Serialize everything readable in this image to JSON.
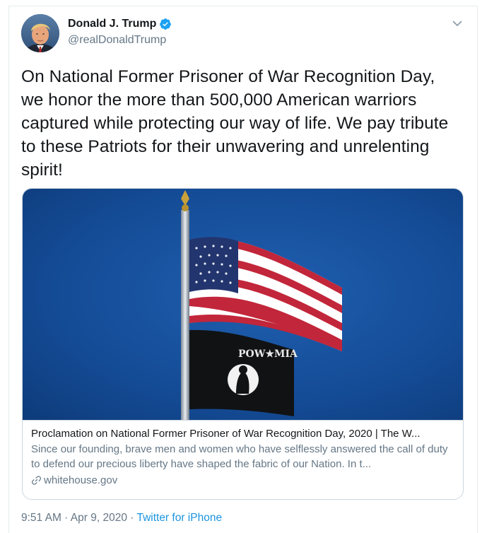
{
  "tweet": {
    "author": {
      "display_name": "Donald J. Trump",
      "handle": "@realDonaldTrump",
      "verified": true,
      "verified_icon": "verified-badge-icon",
      "avatar": "profile-avatar"
    },
    "more_icon": "chevron-down-icon",
    "text": "On National Former Prisoner of War Recognition Day, we honor the more than 500,000 American warriors captured while protecting our way of life. We pay tribute to these Patriots for their unwavering and unrelenting spirit!",
    "card": {
      "image": "flags-photo",
      "title": "Proclamation on National Former Prisoner of War Recognition Day, 2020 | The W...",
      "description": "Since our founding, brave men and women who have selflessly answered the call of duty to defend our precious liberty have shaped the fabric of our Nation.  In t...",
      "domain": "whitehouse.gov",
      "domain_icon": "link-icon",
      "flag_text": "POW★MIA"
    },
    "meta": {
      "time": "9:51 AM",
      "separator1": " · ",
      "date": "Apr 9, 2020",
      "separator2": " · ",
      "source": "Twitter for iPhone"
    }
  },
  "colors": {
    "text": "#14171a",
    "secondary": "#657786",
    "link": "#1b95e0",
    "verified": "#1da1f2",
    "border": "#ccd6dd"
  }
}
